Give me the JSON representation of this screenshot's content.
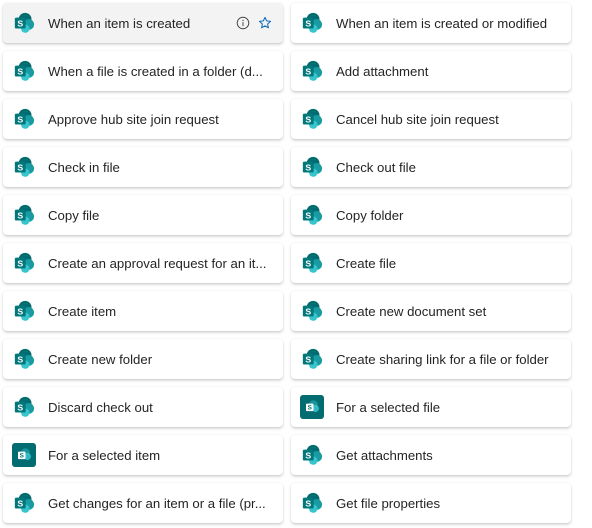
{
  "triggers": [
    {
      "label": "When an item is created",
      "icon": "sharepoint-icon",
      "hovered": true
    },
    {
      "label": "When an item is created or modified",
      "icon": "sharepoint-icon"
    },
    {
      "label": "When a file is created in a folder (d...",
      "icon": "sharepoint-icon"
    },
    {
      "label": "Add attachment",
      "icon": "sharepoint-icon"
    },
    {
      "label": "Approve hub site join request",
      "icon": "sharepoint-icon"
    },
    {
      "label": "Cancel hub site join request",
      "icon": "sharepoint-icon"
    },
    {
      "label": "Check in file",
      "icon": "sharepoint-icon"
    },
    {
      "label": "Check out file",
      "icon": "sharepoint-icon"
    },
    {
      "label": "Copy file",
      "icon": "sharepoint-icon"
    },
    {
      "label": "Copy folder",
      "icon": "sharepoint-icon"
    },
    {
      "label": "Create an approval request for an it...",
      "icon": "sharepoint-icon"
    },
    {
      "label": "Create file",
      "icon": "sharepoint-icon"
    },
    {
      "label": "Create item",
      "icon": "sharepoint-icon"
    },
    {
      "label": "Create new document set",
      "icon": "sharepoint-icon"
    },
    {
      "label": "Create new folder",
      "icon": "sharepoint-icon"
    },
    {
      "label": "Create sharing link for a file or folder",
      "icon": "sharepoint-icon"
    },
    {
      "label": "Discard check out",
      "icon": "sharepoint-icon"
    },
    {
      "label": "For a selected file",
      "icon": "sharepoint-square-icon"
    },
    {
      "label": "For a selected item",
      "icon": "sharepoint-square-icon"
    },
    {
      "label": "Get attachments",
      "icon": "sharepoint-icon"
    },
    {
      "label": "Get changes for an item or a file (pr...",
      "icon": "sharepoint-icon"
    },
    {
      "label": "Get file properties",
      "icon": "sharepoint-icon"
    }
  ],
  "hover_actions": {
    "info_icon": "info-icon",
    "favorite_icon": "star-outline-icon"
  },
  "colors": {
    "sharepoint_dark": "#036c70",
    "sharepoint_mid": "#1a9ba1",
    "sharepoint_light": "#37c6d0",
    "star_blue": "#0f6cbd"
  }
}
